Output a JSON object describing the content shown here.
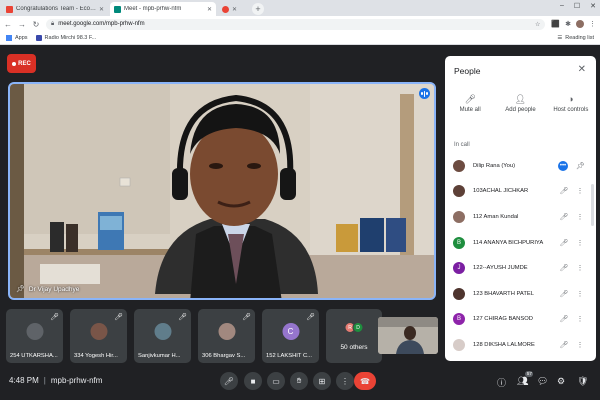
{
  "browser": {
    "tabs": [
      {
        "title": "Congratulations Team - Eco & Ur",
        "favicon": "gmail-icon",
        "active": false
      },
      {
        "title": "Meet - mpb-prhw-nfm",
        "favicon": "meet-icon",
        "active": true
      },
      {
        "title": "",
        "favicon": "recording-icon",
        "active": false
      }
    ],
    "url": "meet.google.com/mpb-prhw-nfm",
    "bookmarks": [
      {
        "label": "Apps",
        "icon": "apps-grid-icon"
      },
      {
        "label": "Radio Mirchi 98.3 F...",
        "icon": "radio-icon"
      }
    ],
    "reading_list": "Reading list"
  },
  "meet": {
    "rec_label": "REC",
    "main_speaker": "Dr Vijay Upadhye",
    "thumbnails": [
      {
        "name": "254 UTKARSHA...",
        "color": "#5f6368"
      },
      {
        "name": "334 Yogesh Hir...",
        "color": "#795548"
      },
      {
        "name": "Sanjivkumar H...",
        "color": "#607d8b"
      },
      {
        "name": "306 Bhargav S...",
        "color": "#a1887f"
      },
      {
        "name": "152 LAKSHIT C...",
        "initial": "C",
        "color": "#9575cd"
      }
    ],
    "others": {
      "label": "50 others",
      "initials": [
        "R",
        "D"
      ],
      "colors": [
        "#e67c73",
        "#1e8e3e"
      ]
    },
    "meeting_time": "4:48 PM",
    "meeting_code": "mpb-prhw-nfm",
    "participant_count": "57"
  },
  "people_panel": {
    "title": "People",
    "actions": [
      {
        "label": "Mute all",
        "icon": "mic-off-icon"
      },
      {
        "label": "Add people",
        "icon": "add-person-icon"
      },
      {
        "label": "Host controls",
        "icon": "toggle-icon"
      }
    ],
    "section_label": "In call",
    "participants": [
      {
        "name": "Dilip Rana (You)",
        "initial": "",
        "color": "#6d4c41"
      },
      {
        "name": "103ACHAL JICHKAR",
        "initial": "",
        "color": "#5d4037"
      },
      {
        "name": "112 Aman Kundal",
        "initial": "",
        "color": "#8d6e63"
      },
      {
        "name": "114 ANANYA BICHPURIYA",
        "initial": "B",
        "color": "#1e8e3e"
      },
      {
        "name": "122--AYUSH JUMDE",
        "initial": "J",
        "color": "#7b1fa2"
      },
      {
        "name": "123 BHAVARTH PATEL",
        "initial": "",
        "color": "#4e342e"
      },
      {
        "name": "127 CHIRAG BANSOD",
        "initial": "B",
        "color": "#8e24aa"
      },
      {
        "name": "128 DIKSHA LALMORE",
        "initial": "",
        "color": "#d7ccc8"
      }
    ]
  }
}
